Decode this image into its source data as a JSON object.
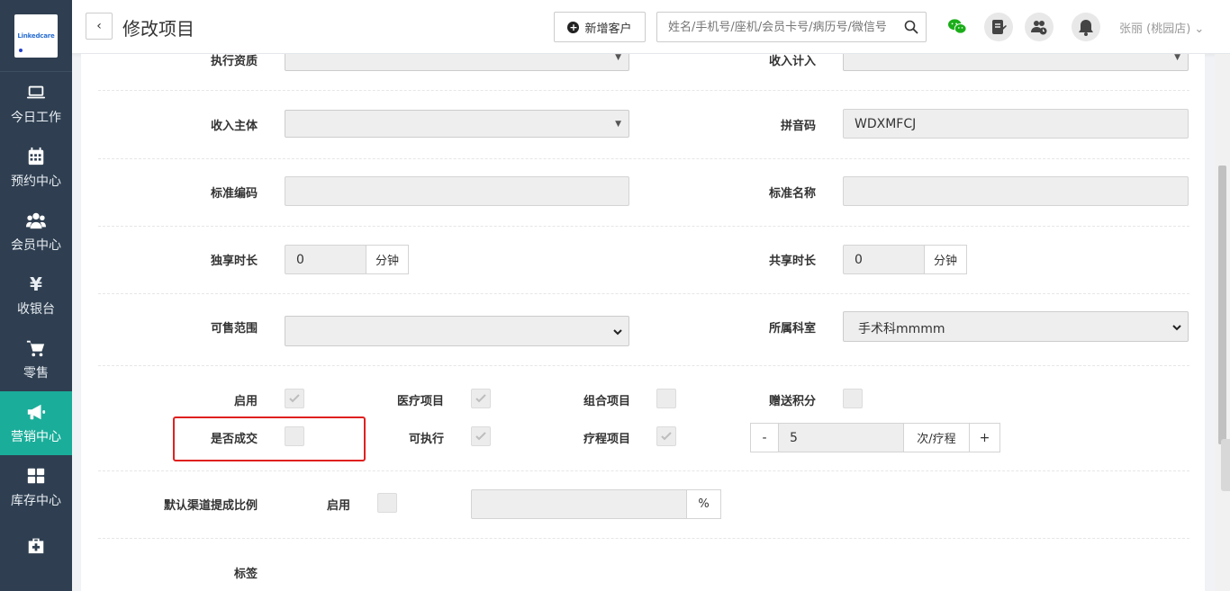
{
  "sidebar": {
    "logo_text": "Linkedcare",
    "items": [
      {
        "label": "今日工作",
        "icon": "laptop-icon"
      },
      {
        "label": "预约中心",
        "icon": "calendar-icon"
      },
      {
        "label": "会员中心",
        "icon": "users-icon"
      },
      {
        "label": "收银台",
        "icon": "yen-icon",
        "glyph": "¥"
      },
      {
        "label": "零售",
        "icon": "cart-icon"
      },
      {
        "label": "营销中心",
        "icon": "megaphone-icon"
      },
      {
        "label": "库存中心",
        "icon": "grid-icon"
      },
      {
        "label": "",
        "icon": "medkit-icon"
      }
    ],
    "active_index": 5
  },
  "header": {
    "back_label": "‹",
    "title": "修改项目",
    "add_customer": "新增客户",
    "search_placeholder": "姓名/手机号/座机/会员卡号/病历号/微信号",
    "user": "张丽 (桃园店) ⌄"
  },
  "form": {
    "exec_qualification_label": "执行资质",
    "income_account_label": "收入计入",
    "income_entity_label": "收入主体",
    "pinyin_label": "拼音码",
    "pinyin_value": "WDXMFCJ",
    "std_code_label": "标准编码",
    "std_code_value": "",
    "std_name_label": "标准名称",
    "std_name_value": "",
    "exclusive_time_label": "独享时长",
    "exclusive_time_value": "0",
    "shared_time_label": "共享时长",
    "shared_time_value": "0",
    "minute_unit": "分钟",
    "sale_scope_label": "可售范围",
    "sale_scope_value": "",
    "department_label": "所属科室",
    "department_value": "手术科mmmm",
    "enabled_label": "启用",
    "medical_item_label": "医疗项目",
    "combo_item_label": "组合项目",
    "gift_points_label": "赠送积分",
    "deal_label": "是否成交",
    "executable_label": "可执行",
    "course_item_label": "疗程项目",
    "course_count_minus": "-",
    "course_count_value": "5",
    "course_count_unit": "次/疗程",
    "course_count_plus": "+",
    "default_channel_label": "默认渠道提成比例",
    "channel_enabled_label": "启用",
    "channel_ratio_value": "",
    "percent_unit": "%",
    "tag_label": "标签"
  },
  "checkboxes": {
    "enabled": true,
    "medical_item": true,
    "combo_item": false,
    "gift_points": false,
    "deal": false,
    "executable": true,
    "course_item": true,
    "channel_enabled": false
  },
  "colors": {
    "sidebar_bg": "#2f3f51",
    "active_nav": "#1aad9a",
    "highlight_border": "#e02020",
    "wechat_green": "#1aad19"
  }
}
